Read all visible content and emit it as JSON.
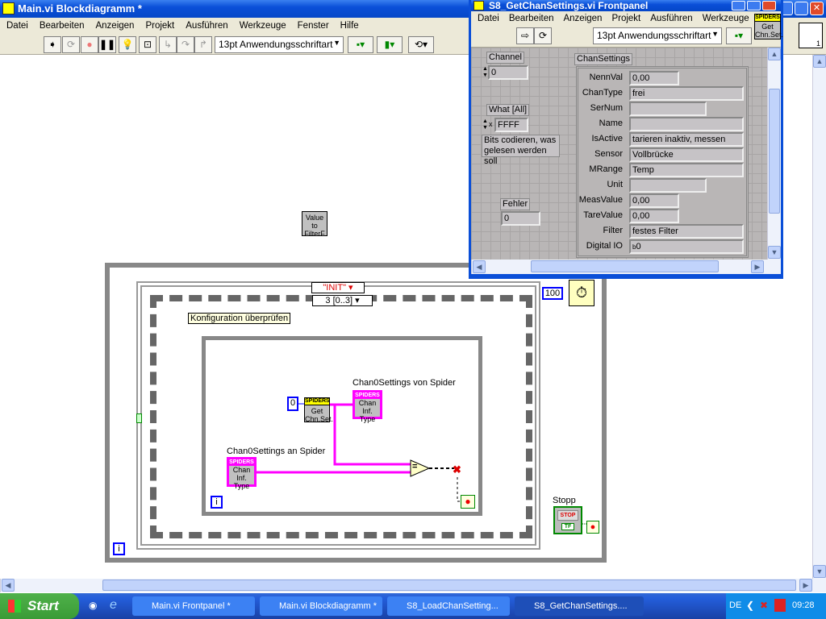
{
  "main_window": {
    "title": "Main.vi Blockdiagramm *",
    "menu": [
      "Datei",
      "Bearbeiten",
      "Anzeigen",
      "Projekt",
      "Ausführen",
      "Werkzeuge",
      "Fenster",
      "Hilfe"
    ],
    "font_select": "13pt Anwendungsschriftart"
  },
  "front_panel": {
    "title": "S8_GetChanSettings.vi Frontpanel",
    "menu": [
      "Datei",
      "Bearbeiten",
      "Anzeigen",
      "Projekt",
      "Ausführen",
      "Werkzeuge",
      "Fe"
    ],
    "font_select": "13pt Anwendungsschriftart",
    "icon_header": "SPIDERS",
    "icon_text": "Get Chn.Set.",
    "channel": {
      "label": "Channel",
      "value": "0"
    },
    "what": {
      "label": "What [All]",
      "radix": "x",
      "value": "FFFF",
      "note": "Bits codieren, was gelesen werden soll"
    },
    "fehler": {
      "label": "Fehler",
      "value": "0"
    },
    "chan_settings": {
      "label": "ChanSettings",
      "rows": [
        {
          "name": "NennVal",
          "value": "0,00"
        },
        {
          "name": "ChanType",
          "value": "frei"
        },
        {
          "name": "SerNum",
          "value": ""
        },
        {
          "name": "Name",
          "value": ""
        },
        {
          "name": "IsActive",
          "value": "tarieren inaktiv, messen"
        },
        {
          "name": "Sensor",
          "value": "Vollbrücke"
        },
        {
          "name": "MRange",
          "value": "Temp"
        },
        {
          "name": "Unit",
          "value": ""
        },
        {
          "name": "MeasValue",
          "value": "0,00"
        },
        {
          "name": "TareValue",
          "value": "0,00"
        },
        {
          "name": "Filter",
          "value": "festes Filter"
        },
        {
          "name": "Digital IO",
          "value": "0",
          "radix": "b"
        }
      ]
    }
  },
  "diagram": {
    "value_to_filter": "Value to FilterF",
    "case_selector": "\"INIT\"",
    "sequence_selector": "3 [0..3]",
    "comment": "Konfiguration überprüfen",
    "wait_ms": "100",
    "channel_const": "0",
    "get_node_header": "SPIDERS",
    "get_node_text": "Get Chn.Set.",
    "indicator_label": "Chan0Settings von Spider",
    "control_label": "Chan0Settings an Spider",
    "cluster_header": "SPIDERS",
    "cluster_text": "Chan Inf. Type",
    "equals": "=",
    "iteration": "i",
    "stop_label": "Stopp",
    "stop_button": "STOP",
    "stop_tf": "TF"
  },
  "taskbar": {
    "start": "Start",
    "tasks": [
      "Main.vi Frontpanel *",
      "Main.vi Blockdiagramm *",
      "S8_LoadChanSetting...",
      "S8_GetChanSettings...."
    ],
    "lang": "DE",
    "clock": "09:28"
  }
}
